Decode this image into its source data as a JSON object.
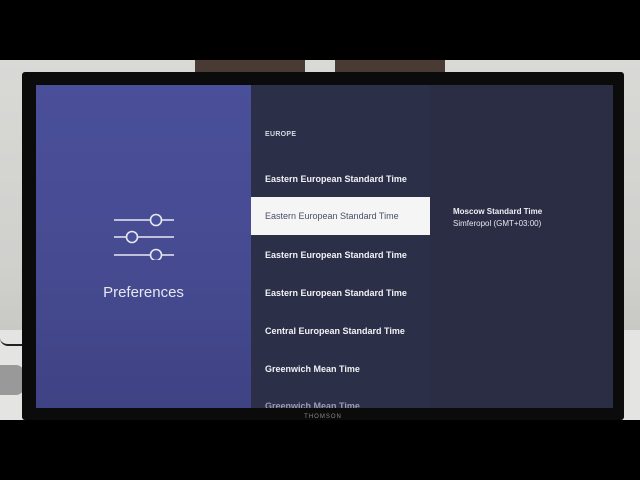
{
  "settings_panel": {
    "title": "Preferences",
    "icon": "sliders-icon"
  },
  "timezone_list": {
    "section": "EUROPE",
    "items": [
      {
        "label": "Eastern European Standard Time",
        "selected": false
      },
      {
        "label": "Eastern European Standard Time",
        "selected": true
      },
      {
        "label": "Eastern European Standard Time",
        "selected": false
      },
      {
        "label": "Eastern European Standard Time",
        "selected": false
      },
      {
        "label": "Central European Standard Time",
        "selected": false
      },
      {
        "label": "Greenwich Mean Time",
        "selected": false
      },
      {
        "label": "Greenwich Mean Time",
        "selected": false
      }
    ]
  },
  "detail": {
    "title": "Moscow Standard Time",
    "subtitle": "Simferopol (GMT+03:00)"
  },
  "tv": {
    "brand": "THOMSON"
  },
  "colors": {
    "left_pane": "#474b92",
    "list_bg": "#2c2f48",
    "selected_bg": "#f5f5f5",
    "text": "#f2f2f6"
  }
}
